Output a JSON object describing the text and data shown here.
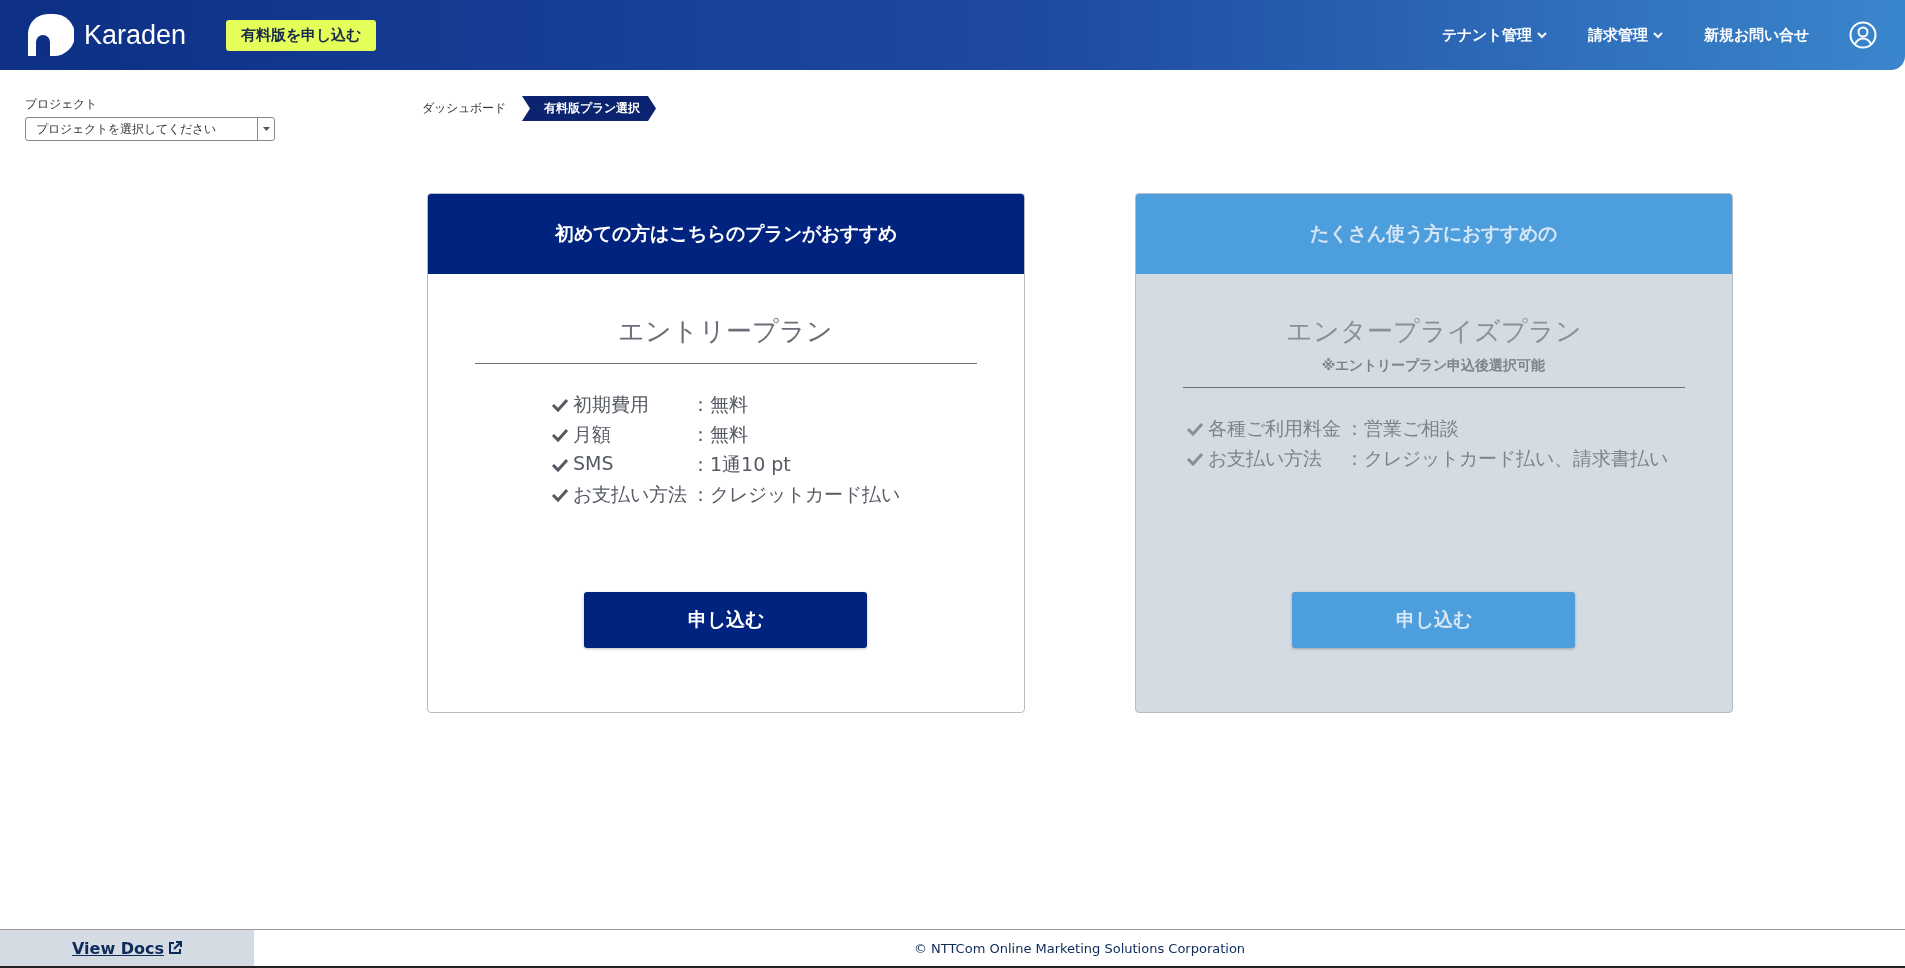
{
  "header": {
    "logo_text": "Karaden",
    "cta": "有料版を申し込む",
    "nav": [
      {
        "label": "テナント管理",
        "kind": "dropdown"
      },
      {
        "label": "請求管理",
        "kind": "dropdown"
      },
      {
        "label": "新規お問い合せ",
        "kind": "link"
      }
    ]
  },
  "project": {
    "label": "プロジェクト",
    "placeholder": "プロジェクトを選択してください"
  },
  "breadcrumb": [
    {
      "label": "ダッシュボード",
      "selected": false
    },
    {
      "label": "有料版プラン選択",
      "selected": true
    }
  ],
  "plans": [
    {
      "header": "初めての方はこちらのプランがおすすめ",
      "name": "エントリープラン",
      "disabled": false,
      "features": [
        {
          "label": "初期費用",
          "value": "：無料"
        },
        {
          "label": "月額",
          "value": "：無料"
        },
        {
          "label": "SMS",
          "value": "：1通10 pt"
        },
        {
          "label": "お支払い方法",
          "value": "：クレジットカード払い"
        }
      ],
      "button": "申し込む"
    },
    {
      "header": "たくさん使う方におすすめの",
      "name": "エンタープライズプラン",
      "note": "※エントリープラン申込後選択可能",
      "disabled": true,
      "features": [
        {
          "label": "各種ご利用料金",
          "value": "：営業ご相談"
        },
        {
          "label": "お支払い方法",
          "value": "：クレジットカード払い、請求書払い"
        }
      ],
      "button": "申し込む"
    }
  ],
  "footer": {
    "docs": "View Docs",
    "copyright": "© NTTCom Online Marketing Solutions Corporation"
  }
}
